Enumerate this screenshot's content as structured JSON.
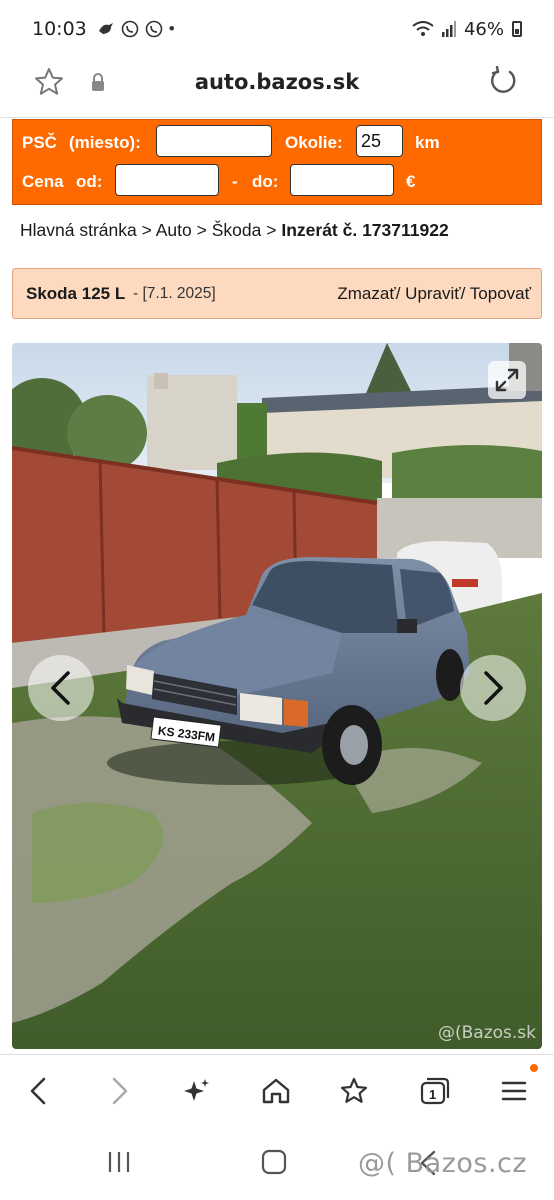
{
  "status_bar": {
    "time": "10:03",
    "notif_dot": "•",
    "battery": "46%",
    "icons": [
      "bird-icon",
      "viber-icon",
      "viber-icon",
      "wifi-icon",
      "signal-icon",
      "battery-icon"
    ]
  },
  "address_bar": {
    "url": "auto.bazos.sk"
  },
  "search": {
    "psc_label": "PSČ",
    "miesto_label": "(miesto):",
    "psc_value": "",
    "okolie_label": "Okolie:",
    "okolie_value": "25",
    "km_label": "km",
    "cena_label": "Cena",
    "od_label": "od:",
    "od_value": "",
    "dash": "-",
    "do_label": "do:",
    "do_value": "",
    "currency": "€"
  },
  "breadcrumb": {
    "items": [
      "Hlavná stránka",
      "Auto",
      "Škoda"
    ],
    "separator": ">",
    "current": "Inzerát č. 173711922"
  },
  "ad": {
    "title": "Skoda 125 L",
    "date": "- [7.1. 2025]",
    "actions": "Zmazať/ Upraviť/ Topovať"
  },
  "photo": {
    "plate": "KS 233FM",
    "watermark": "@(Bazos.sk"
  },
  "system": {
    "watermark": "@( Bazos.cz"
  },
  "colors": {
    "accent": "#ff6a00",
    "ad_header_bg": "#fdd9c0"
  }
}
